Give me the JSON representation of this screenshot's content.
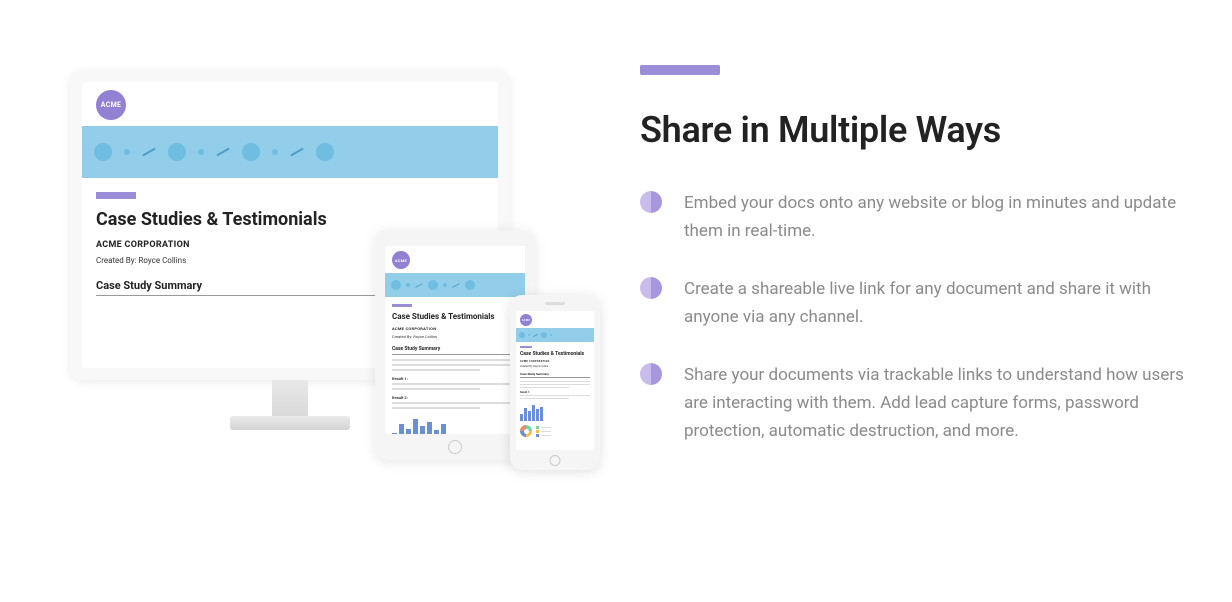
{
  "heading": "Share in Multiple Ways",
  "features": [
    "Embed your docs onto any website or blog in minutes and update them in real-time.",
    "Create a shareable live link for any document and share it with anyone via any channel.",
    "Share your documents via trackable links to understand how users are interacting with them. Add lead capture forms, password protection, automatic destruction, and more."
  ],
  "document": {
    "logo_text": "ACME",
    "title": "Case Studies & Testimonials",
    "subtitle": "ACME CORPORATION",
    "byline": "Created By: Royce Collins",
    "section": "Case Study Summary",
    "result1": "Result 1:",
    "result2": "Result 2:"
  }
}
